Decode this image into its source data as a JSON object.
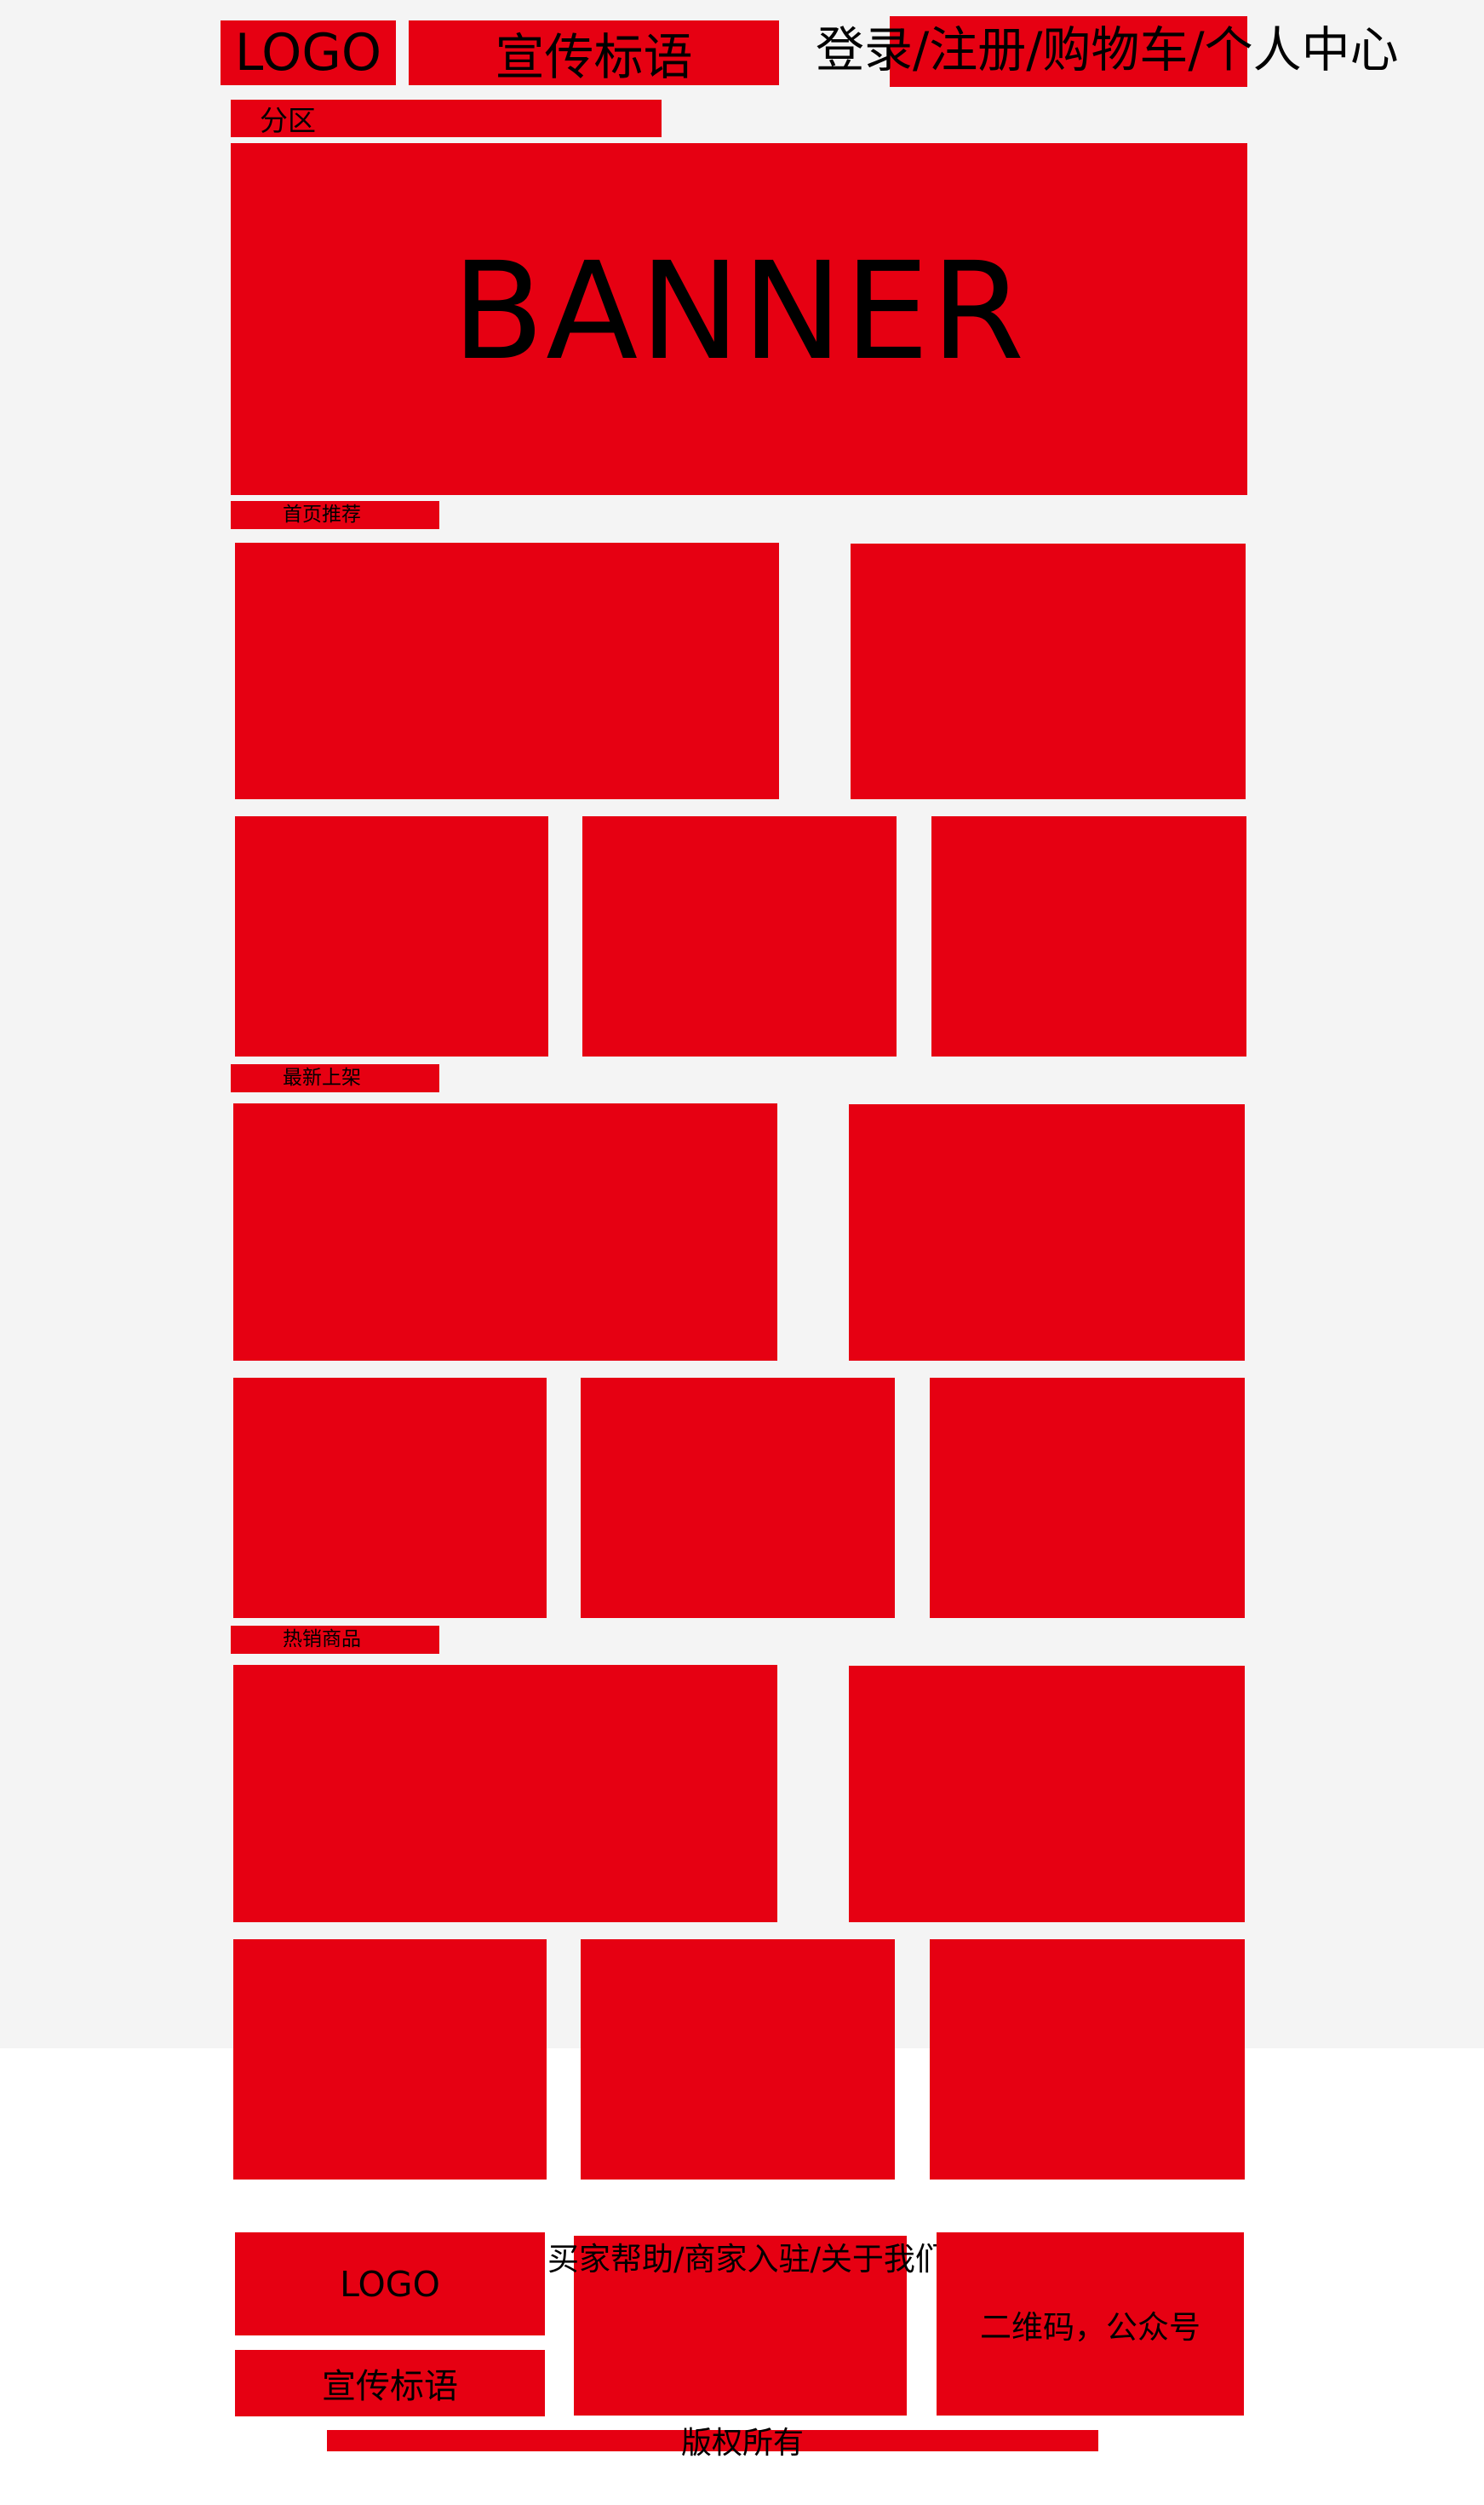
{
  "header": {
    "logo": "LOGO",
    "slogan": "宣传标语",
    "user_links": "登录/注册/购物车/个人中心"
  },
  "category_nav": {
    "label": "分区"
  },
  "banner": {
    "label": "BANNER"
  },
  "sections": [
    {
      "title": "首页推荐"
    },
    {
      "title": "最新上架"
    },
    {
      "title": "热销商品"
    }
  ],
  "footer": {
    "logo": "LOGO",
    "slogan": "宣传标语",
    "help_links": "买家帮助/商家入驻/关于我们",
    "qr_text": "二维码，公众号",
    "copyright": "版权所有"
  },
  "colors": {
    "block_red": "#e60012",
    "page_gray": "#f4f4f4"
  }
}
